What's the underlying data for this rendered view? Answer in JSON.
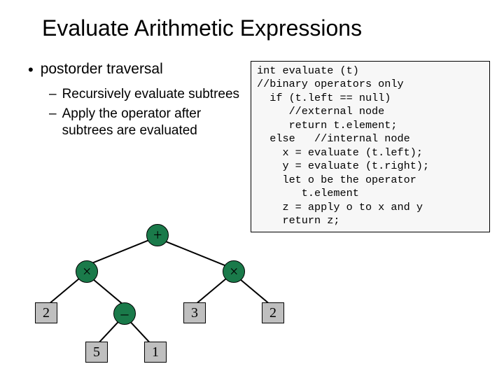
{
  "title": "Evaluate Arithmetic Expressions",
  "bullet": "postorder traversal",
  "sub1": "Recursively evaluate subtrees",
  "sub2": "Apply the operator after subtrees are evaluated",
  "code": "int evaluate (t)\n//binary operators only\n  if (t.left == null)\n     //external node\n     return t.element;\n  else   //internal node\n    x = evaluate (t.left);\n    y = evaluate (t.right);\n    let o be the operator\n       t.element\n    z = apply o to x and y\n    return z;",
  "tree": {
    "root": "+",
    "l": "×",
    "r": "×",
    "ll": "2",
    "lr": "–",
    "lrl": "5",
    "lrr": "1",
    "rl": "3",
    "rr": "2"
  },
  "chart_data": {
    "type": "tree",
    "description": "Expression tree for (2 × (5 − 1)) + (3 × 2)",
    "nodes": [
      {
        "id": "n1",
        "label": "+",
        "kind": "operator",
        "children": [
          "n2",
          "n3"
        ]
      },
      {
        "id": "n2",
        "label": "×",
        "kind": "operator",
        "children": [
          "n4",
          "n5"
        ]
      },
      {
        "id": "n3",
        "label": "×",
        "kind": "operator",
        "children": [
          "n6",
          "n7"
        ]
      },
      {
        "id": "n4",
        "label": "2",
        "kind": "leaf"
      },
      {
        "id": "n5",
        "label": "−",
        "kind": "operator",
        "children": [
          "n8",
          "n9"
        ]
      },
      {
        "id": "n6",
        "label": "3",
        "kind": "leaf"
      },
      {
        "id": "n7",
        "label": "2",
        "kind": "leaf"
      },
      {
        "id": "n8",
        "label": "5",
        "kind": "leaf"
      },
      {
        "id": "n9",
        "label": "1",
        "kind": "leaf"
      }
    ]
  }
}
